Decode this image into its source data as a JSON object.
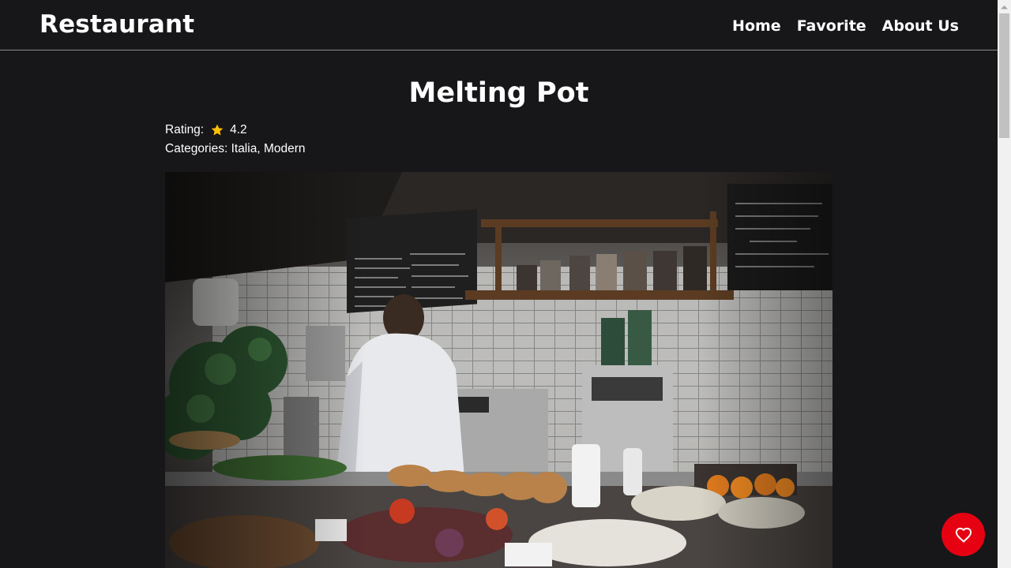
{
  "header": {
    "brand": "Restaurant",
    "nav": [
      {
        "label": "Home"
      },
      {
        "label": "Favorite"
      },
      {
        "label": "About Us"
      }
    ]
  },
  "restaurant": {
    "name": "Melting Pot",
    "rating_label": "Rating:",
    "rating_value": "4.2",
    "categories_label": "Categories:",
    "categories": [
      "Italia",
      "Modern"
    ],
    "category_separator": ","
  },
  "icons": {
    "rating": "star-icon",
    "fab": "heart-outline-icon"
  },
  "colors": {
    "background": "#17171a",
    "star": "#ffc107",
    "fab": "#e60012"
  }
}
